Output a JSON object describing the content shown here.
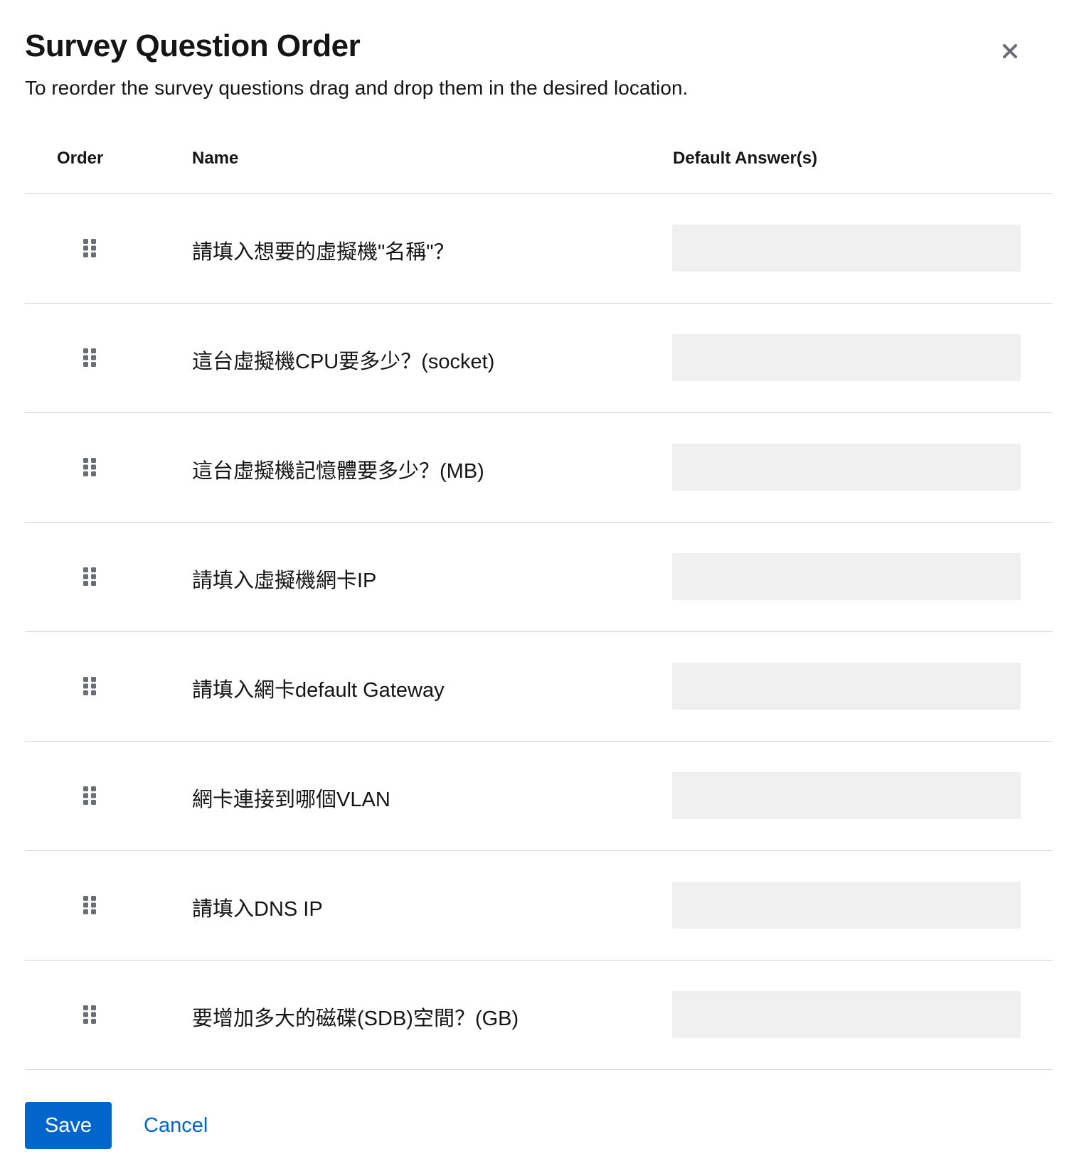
{
  "modal": {
    "title": "Survey Question Order",
    "description": "To reorder the survey questions drag and drop them in the desired location.",
    "close_icon": "close-icon"
  },
  "table": {
    "headers": {
      "order": "Order",
      "name": "Name",
      "default_answers": "Default Answer(s)"
    },
    "rows": [
      {
        "name": "請填入想要的虛擬機\"名稱\"？",
        "default_answer": ""
      },
      {
        "name": "這台虛擬機CPU要多少？(socket)",
        "default_answer": ""
      },
      {
        "name": "這台虛擬機記憶體要多少？(MB)",
        "default_answer": ""
      },
      {
        "name": "請填入虛擬機網卡IP",
        "default_answer": ""
      },
      {
        "name": "請填入網卡default Gateway",
        "default_answer": ""
      },
      {
        "name": "網卡連接到哪個VLAN",
        "default_answer": ""
      },
      {
        "name": "請填入DNS IP",
        "default_answer": ""
      },
      {
        "name": "要增加多大的磁碟(SDB)空間？(GB)",
        "default_answer": ""
      }
    ],
    "drag_icon": "grip-vertical-icon"
  },
  "footer": {
    "save_label": "Save",
    "cancel_label": "Cancel"
  },
  "colors": {
    "primary": "#0066cc",
    "text": "#151515",
    "answer_bg": "#f0f0f0",
    "divider": "#d2d2d2",
    "icon": "#6a6e73"
  }
}
